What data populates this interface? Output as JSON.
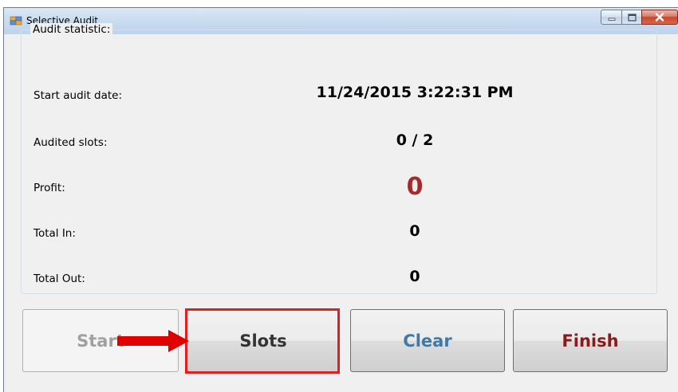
{
  "window": {
    "title": "Selective Audit",
    "icon": "windows-app-icon",
    "controls": [
      "minimize-icon",
      "maximize-icon",
      "close-icon"
    ]
  },
  "statistics": {
    "group_title": "Audit statistic:",
    "start_audit_date": {
      "label": "Start audit date:",
      "value": "11/24/2015 3:22:31 PM"
    },
    "audited_slots": {
      "label": "Audited slots:",
      "value": "0 / 2"
    },
    "profit": {
      "label": "Profit:",
      "value": "0"
    },
    "total_in": {
      "label": "Total In:",
      "value": "0"
    },
    "total_out": {
      "label": "Total Out:",
      "value": "0"
    }
  },
  "buttons": {
    "start": "Start",
    "slots": "Slots",
    "clear": "Clear",
    "finish": "Finish"
  },
  "annotation": {
    "highlight_color": "#e02020",
    "arrow_color": "#e00000",
    "highlighted": "slots-button"
  },
  "colors": {
    "profit": "#a52a2a",
    "clear": "#3f79a8",
    "finish": "#8b1a1a",
    "disabled": "#a0a0a0"
  }
}
